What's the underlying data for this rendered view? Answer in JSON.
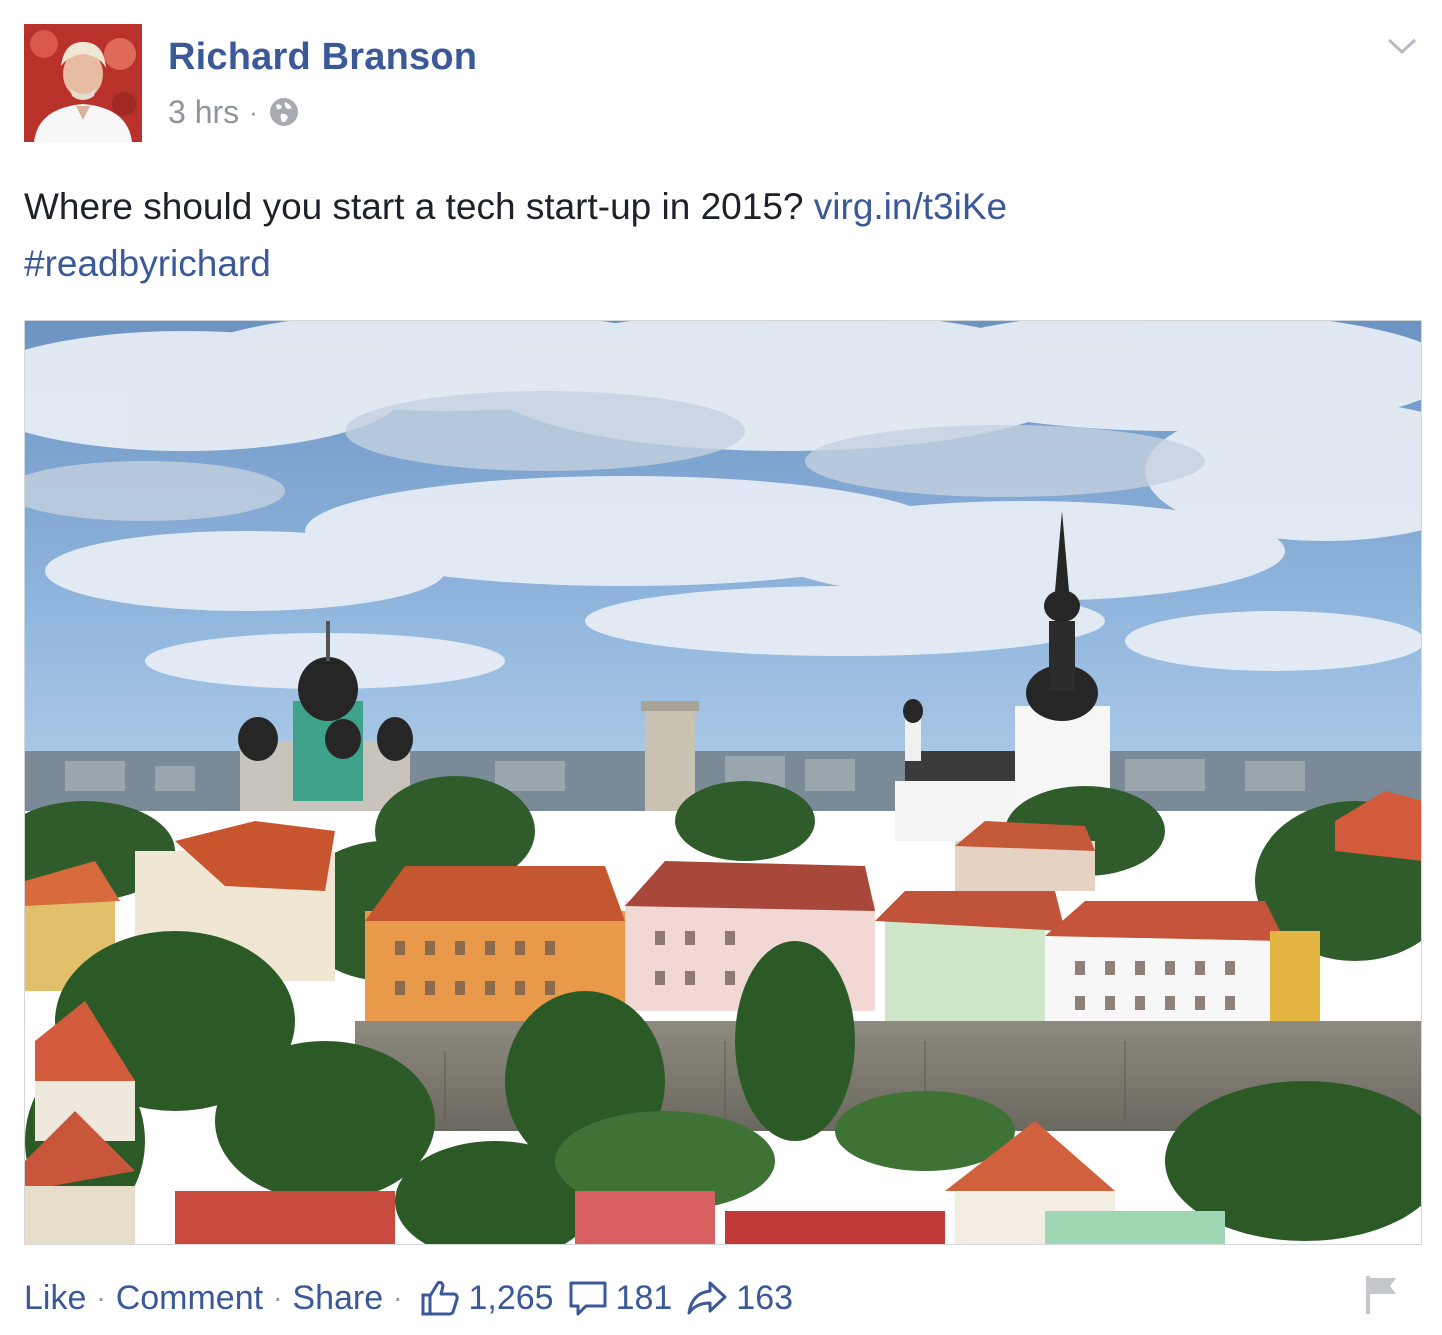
{
  "post": {
    "author": "Richard Branson",
    "timestamp": "3 hrs",
    "separator": "·",
    "audience_icon": "globe-icon",
    "text": "Where should you start a tech start-up in 2015?",
    "link_text": "virg.in/t3iKe",
    "hashtag": "#readbyrichard",
    "photo_icon": "tallinn-old-town-photo"
  },
  "actions": {
    "like": "Like",
    "comment": "Comment",
    "share": "Share",
    "separator": "·"
  },
  "stats": {
    "likes": "1,265",
    "comments": "181",
    "shares": "163"
  },
  "colors": {
    "link": "#3b5998",
    "meta": "#90949c",
    "text": "#1d2129"
  }
}
